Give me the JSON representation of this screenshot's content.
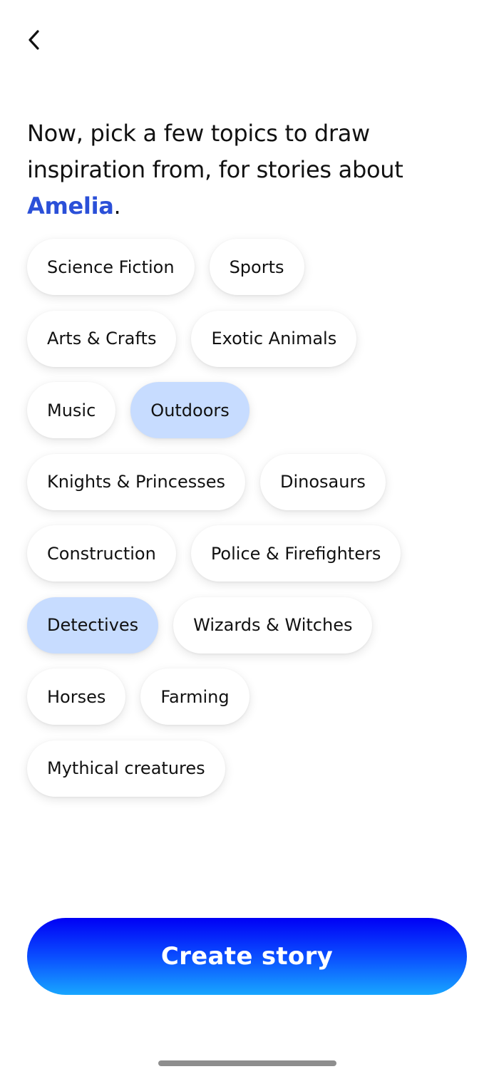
{
  "nav": {
    "back_icon": "chevron-left-icon"
  },
  "heading": {
    "text_before": "Now, pick a few topics to draw inspiration from, for stories about",
    "name": "Amelia",
    "text_after": "."
  },
  "colors": {
    "accent_name": "#2b50d8",
    "chip_selected_bg": "#c7dcff",
    "chip_bg": "#ffffff",
    "button_gradient_top": "#0000f5",
    "button_gradient_bottom": "#18a6ff"
  },
  "topics": {
    "rows": [
      [
        {
          "label": "Science Fiction",
          "selected": false
        },
        {
          "label": "Sports",
          "selected": false
        }
      ],
      [
        {
          "label": "Arts & Crafts",
          "selected": false
        },
        {
          "label": "Exotic Animals",
          "selected": false
        }
      ],
      [
        {
          "label": "Music",
          "selected": false
        },
        {
          "label": "Outdoors",
          "selected": true
        }
      ],
      [
        {
          "label": "Knights & Princesses",
          "selected": false
        },
        {
          "label": "Dinosaurs",
          "selected": false
        }
      ],
      [
        {
          "label": "Construction",
          "selected": false
        },
        {
          "label": "Police & Firefighters",
          "selected": false
        }
      ],
      [
        {
          "label": "Detectives",
          "selected": true
        },
        {
          "label": "Wizards & Witches",
          "selected": false
        }
      ],
      [
        {
          "label": "Horses",
          "selected": false
        },
        {
          "label": "Farming",
          "selected": false
        }
      ],
      [
        {
          "label": "Mythical creatures",
          "selected": false
        }
      ]
    ]
  },
  "create_button": {
    "label": "Create story"
  }
}
